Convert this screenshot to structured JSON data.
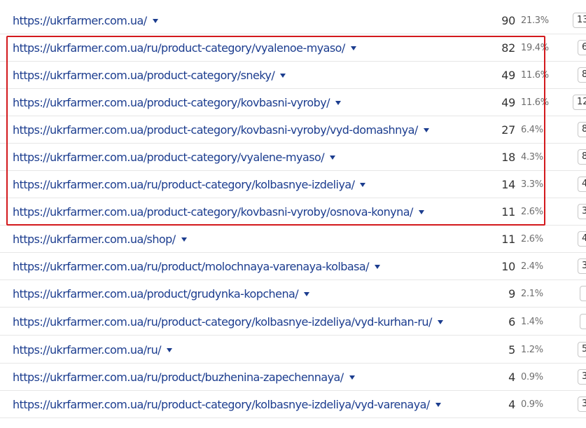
{
  "rows": [
    {
      "url": "https://ukrfarmer.com.ua/",
      "count": "90",
      "pct": "21.3%",
      "side": "13"
    },
    {
      "url": "https://ukrfarmer.com.ua/ru/product-category/vyalenoe-myaso/",
      "count": "82",
      "pct": "19.4%",
      "side": "6"
    },
    {
      "url": "https://ukrfarmer.com.ua/product-category/sneky/",
      "count": "49",
      "pct": "11.6%",
      "side": "8"
    },
    {
      "url": "https://ukrfarmer.com.ua/product-category/kovbasni-vyroby/",
      "count": "49",
      "pct": "11.6%",
      "side": "12"
    },
    {
      "url": "https://ukrfarmer.com.ua/product-category/kovbasni-vyroby/vyd-domashnya/",
      "count": "27",
      "pct": "6.4%",
      "side": "8"
    },
    {
      "url": "https://ukrfarmer.com.ua/product-category/vyalene-myaso/",
      "count": "18",
      "pct": "4.3%",
      "side": "8"
    },
    {
      "url": "https://ukrfarmer.com.ua/ru/product-category/kolbasnye-izdeliya/",
      "count": "14",
      "pct": "3.3%",
      "side": "4"
    },
    {
      "url": "https://ukrfarmer.com.ua/product-category/kovbasni-vyroby/osnova-konyna/",
      "count": "11",
      "pct": "2.6%",
      "side": "3"
    },
    {
      "url": "https://ukrfarmer.com.ua/shop/",
      "count": "11",
      "pct": "2.6%",
      "side": "4"
    },
    {
      "url": "https://ukrfarmer.com.ua/ru/product/molochnaya-varenaya-kolbasa/",
      "count": "10",
      "pct": "2.4%",
      "side": "3"
    },
    {
      "url": "https://ukrfarmer.com.ua/product/grudynka-kopchena/",
      "count": "9",
      "pct": "2.1%",
      "side": ""
    },
    {
      "url": "https://ukrfarmer.com.ua/ru/product-category/kolbasnye-izdeliya/vyd-kurhan-ru/",
      "count": "6",
      "pct": "1.4%",
      "side": ""
    },
    {
      "url": "https://ukrfarmer.com.ua/ru/",
      "count": "5",
      "pct": "1.2%",
      "side": "5"
    },
    {
      "url": "https://ukrfarmer.com.ua/ru/product/buzhenina-zapechennaya/",
      "count": "4",
      "pct": "0.9%",
      "side": "3"
    },
    {
      "url": "https://ukrfarmer.com.ua/ru/product-category/kolbasnye-izdeliya/vyd-varenaya/",
      "count": "4",
      "pct": "0.9%",
      "side": "3"
    }
  ],
  "colors": {
    "link": "#1c3d8f",
    "highlight": "#d3191d",
    "divider": "#e6e6e6"
  },
  "icons": {
    "dropdown": "caret-down-icon"
  }
}
